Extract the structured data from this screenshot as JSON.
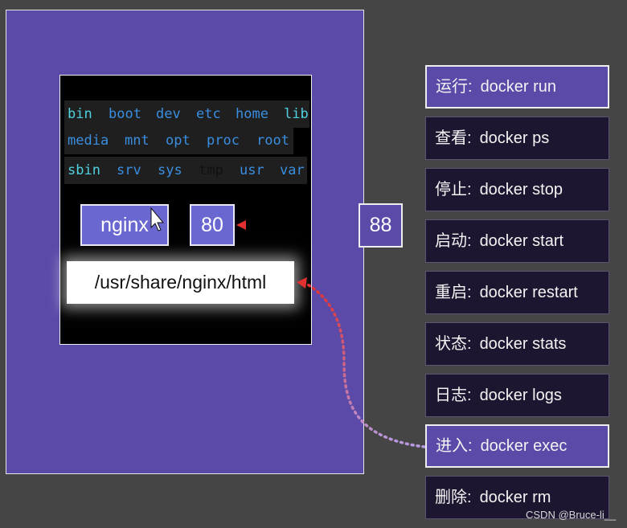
{
  "directories": {
    "row1": [
      "bin",
      "boot",
      "dev",
      "etc",
      "home",
      "lib"
    ],
    "row2": [
      "media",
      "mnt",
      "opt",
      "proc",
      "root"
    ],
    "row3": [
      "sbin",
      "srv",
      "sys",
      "tmp",
      "usr",
      "var"
    ]
  },
  "container": {
    "image": "nginx",
    "port": "80",
    "path": "/usr/share/nginx/html"
  },
  "host_port": "88",
  "commands": [
    {
      "label": "运行:",
      "cmd": "docker run"
    },
    {
      "label": "查看:",
      "cmd": "docker ps"
    },
    {
      "label": "停止:",
      "cmd": "docker stop"
    },
    {
      "label": "启动:",
      "cmd": "docker start"
    },
    {
      "label": "重启:",
      "cmd": "docker restart"
    },
    {
      "label": "状态:",
      "cmd": "docker stats"
    },
    {
      "label": "日志:",
      "cmd": "docker logs"
    },
    {
      "label": "进入:",
      "cmd": "docker exec"
    },
    {
      "label": "删除:",
      "cmd": "docker rm"
    }
  ],
  "watermark": "CSDN @Bruce-li__",
  "colors": {
    "host": "#5b4aa8",
    "pill": "#6a68d0",
    "arrow_red": "#e03030",
    "arrow_lilac": "#b79ae0",
    "dir_blue": "#3a8ee0",
    "dir_cyan": "#4fd0e0",
    "highlight": "#8fd42a"
  }
}
